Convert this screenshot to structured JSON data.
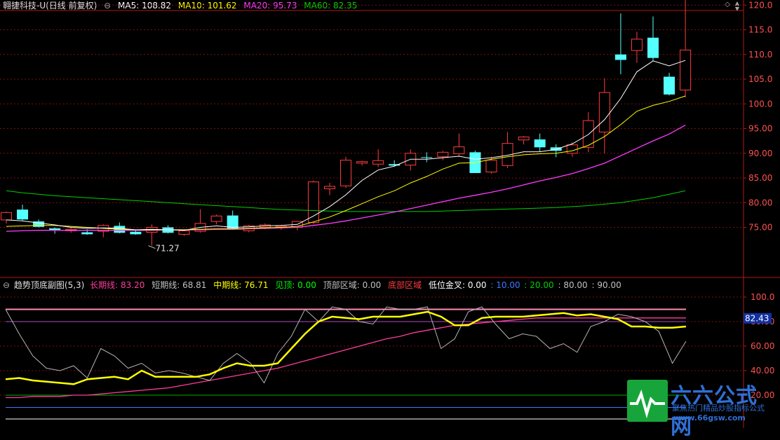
{
  "main_header": {
    "stock": "翱捷科技-U(日线 前复权)",
    "ma5": "MA5: 108.82",
    "ma10": "MA10: 101.62",
    "ma20": "MA20: 95.73",
    "ma60": "MA60: 82.35"
  },
  "sub_header": {
    "name": "趋势顶底副图(5,3)",
    "long": "长期线: 83.20",
    "short": "短期线: 68.81",
    "mid": "中期线: 76.71",
    "jianding": "见顶: 0.00",
    "top_zone": "顶部区域: 0.00",
    "bottom_zone": "底部区域",
    "low_cross": "低位金叉: 0.00",
    "v10": ": 10.00",
    "v20": ": 20.00",
    "v80": ": 80.00",
    "v90": ": 90.00"
  },
  "controls": {
    "diamond": "◇",
    "up": "▲",
    "down": "▼"
  },
  "colors": {
    "up": "#ff3c3c",
    "down": "#54ffff",
    "ma5": "#ffffff",
    "ma10": "#ffff00",
    "ma20": "#ff3cff",
    "ma60": "#00d000",
    "grid": "#7a1010",
    "axis": "#b01818"
  },
  "price_axis": {
    "ticks": [
      "120.0",
      "115.0",
      "110.0",
      "105.0",
      "100.0",
      "95.00",
      "90.00",
      "85.00",
      "80.00",
      "75.00"
    ]
  },
  "price_annotations": {
    "high": "122.40",
    "low": "71.27"
  },
  "sub_axis": {
    "ticks": [
      "100.0",
      "80.00",
      "60.00",
      "40.00",
      "20.00"
    ],
    "current": "82.43"
  },
  "chart_data": {
    "type": "candlestick",
    "ylim": [
      70,
      124
    ],
    "candles": [
      {
        "o": 76.5,
        "h": 78.2,
        "l": 75.8,
        "c": 78
      },
      {
        "o": 78.6,
        "h": 79.6,
        "l": 76.4,
        "c": 76.6
      },
      {
        "o": 76.2,
        "h": 76.6,
        "l": 75.0,
        "c": 75.1
      },
      {
        "o": 74.8,
        "h": 75.0,
        "l": 73.7,
        "c": 74.5
      },
      {
        "o": 74.3,
        "h": 74.9,
        "l": 73.9,
        "c": 74.6
      },
      {
        "o": 74.0,
        "h": 74.6,
        "l": 73.5,
        "c": 73.6
      },
      {
        "o": 74.2,
        "h": 75.6,
        "l": 73.0,
        "c": 75.4
      },
      {
        "o": 75.3,
        "h": 76.0,
        "l": 73.8,
        "c": 73.9
      },
      {
        "o": 74.1,
        "h": 74.6,
        "l": 73.5,
        "c": 73.6
      },
      {
        "o": 74.0,
        "h": 75.6,
        "l": 71.3,
        "c": 75.0
      },
      {
        "o": 75.0,
        "h": 75.4,
        "l": 73.8,
        "c": 73.9
      },
      {
        "o": 73.6,
        "h": 74.5,
        "l": 73.3,
        "c": 74.3
      },
      {
        "o": 74.2,
        "h": 78.7,
        "l": 73.9,
        "c": 75.8
      },
      {
        "o": 76.2,
        "h": 77.6,
        "l": 75.6,
        "c": 77.3
      },
      {
        "o": 77.4,
        "h": 78.4,
        "l": 74.6,
        "c": 74.8
      },
      {
        "o": 74.3,
        "h": 75.5,
        "l": 74.0,
        "c": 75.3
      },
      {
        "o": 75.0,
        "h": 75.8,
        "l": 74.6,
        "c": 75.5
      },
      {
        "o": 75.0,
        "h": 75.5,
        "l": 74.5,
        "c": 75.2
      },
      {
        "o": 75.0,
        "h": 76.3,
        "l": 74.4,
        "c": 76.2
      },
      {
        "o": 76.0,
        "h": 84.5,
        "l": 75.6,
        "c": 84.2
      },
      {
        "o": 82.8,
        "h": 84.0,
        "l": 81.5,
        "c": 83.3
      },
      {
        "o": 83.4,
        "h": 89.3,
        "l": 83.0,
        "c": 88.6
      },
      {
        "o": 88.0,
        "h": 88.5,
        "l": 87.5,
        "c": 88.3
      },
      {
        "o": 87.8,
        "h": 90.8,
        "l": 87.2,
        "c": 88.5
      },
      {
        "o": 87.8,
        "h": 88.6,
        "l": 87.3,
        "c": 87.5
      },
      {
        "o": 87.6,
        "h": 90.8,
        "l": 86.5,
        "c": 90.0
      },
      {
        "o": 89.2,
        "h": 90.2,
        "l": 88.2,
        "c": 89.1
      },
      {
        "o": 89.3,
        "h": 90.5,
        "l": 88.6,
        "c": 90.2
      },
      {
        "o": 89.9,
        "h": 94.0,
        "l": 89.3,
        "c": 91.3
      },
      {
        "o": 90.2,
        "h": 90.5,
        "l": 86.0,
        "c": 86.0
      },
      {
        "o": 86.2,
        "h": 89.3,
        "l": 85.9,
        "c": 88.6
      },
      {
        "o": 87.5,
        "h": 94.3,
        "l": 87.0,
        "c": 92.0
      },
      {
        "o": 92.7,
        "h": 93.5,
        "l": 91.8,
        "c": 93.3
      },
      {
        "o": 92.8,
        "h": 94.0,
        "l": 90.3,
        "c": 91.2
      },
      {
        "o": 91.2,
        "h": 91.8,
        "l": 89.2,
        "c": 90.5
      },
      {
        "o": 90.0,
        "h": 92.2,
        "l": 89.3,
        "c": 91.7
      },
      {
        "o": 91.2,
        "h": 98.3,
        "l": 90.2,
        "c": 96.6
      },
      {
        "o": 94.3,
        "h": 105.2,
        "l": 90.0,
        "c": 102.3
      },
      {
        "o": 110.0,
        "h": 118.3,
        "l": 106.0,
        "c": 108.9
      },
      {
        "o": 110.8,
        "h": 114.6,
        "l": 108.3,
        "c": 113.1
      },
      {
        "o": 113.4,
        "h": 117.7,
        "l": 108.7,
        "c": 109.3
      },
      {
        "o": 105.5,
        "h": 106.3,
        "l": 101.7,
        "c": 101.9
      },
      {
        "o": 102.8,
        "h": 122.4,
        "l": 101.3,
        "c": 110.9
      }
    ],
    "ma5": [
      76.5,
      76.3,
      75.9,
      75.5,
      75.0,
      74.8,
      74.9,
      74.8,
      74.5,
      74.6,
      74.5,
      74.4,
      75.0,
      75.3,
      75.0,
      75.1,
      75.3,
      75.4,
      75.6,
      77.3,
      79.2,
      81.6,
      84.5,
      86.6,
      87.4,
      88.8,
      88.8,
      89.1,
      89.4,
      88.8,
      89.1,
      89.6,
      90.3,
      90.3,
      90.8,
      91.9,
      93.8,
      96.8,
      101.1,
      106.5,
      108.7,
      107.7,
      108.8
    ],
    "ma10": [
      75.2,
      75.3,
      75.4,
      75.4,
      75.2,
      75.0,
      74.8,
      74.6,
      74.5,
      74.5,
      74.5,
      74.5,
      74.6,
      74.7,
      74.7,
      74.8,
      74.9,
      75.0,
      75.2,
      76.1,
      77.1,
      78.4,
      79.8,
      81.2,
      82.4,
      84.0,
      85.3,
      86.8,
      88.0,
      88.1,
      88.8,
      89.3,
      89.7,
      89.9,
      90.0,
      90.5,
      91.6,
      93.4,
      95.8,
      98.5,
      99.7,
      100.5,
      101.6
    ],
    "ma20": [
      74.2,
      74.3,
      74.4,
      74.4,
      74.4,
      74.4,
      74.4,
      74.4,
      74.4,
      74.4,
      74.5,
      74.5,
      74.5,
      74.6,
      74.6,
      74.7,
      74.8,
      74.9,
      75.0,
      75.4,
      75.8,
      76.3,
      76.9,
      77.5,
      78.1,
      78.8,
      79.5,
      80.2,
      80.9,
      81.5,
      82.1,
      82.8,
      83.6,
      84.4,
      85.1,
      85.9,
      86.9,
      88.0,
      89.5,
      91.0,
      92.5,
      93.9,
      95.7
    ],
    "ma60": [
      82.4,
      82.0,
      81.7,
      81.4,
      81.2,
      81.0,
      80.8,
      80.6,
      80.4,
      80.2,
      80.0,
      79.8,
      79.6,
      79.4,
      79.2,
      79.0,
      78.8,
      78.6,
      78.5,
      78.4,
      78.3,
      78.2,
      78.2,
      78.2,
      78.2,
      78.2,
      78.2,
      78.3,
      78.4,
      78.5,
      78.6,
      78.7,
      78.8,
      78.9,
      79.0,
      79.2,
      79.4,
      79.7,
      80.0,
      80.5,
      81.0,
      81.7,
      82.4
    ],
    "sub": {
      "ylim": [
        0,
        108
      ],
      "short": [
        90,
        70,
        52,
        42,
        40,
        44,
        34,
        58,
        52,
        42,
        46,
        38,
        40,
        38,
        35,
        32,
        46,
        54,
        46,
        30,
        54,
        68,
        90,
        80,
        92,
        90,
        80,
        78,
        92,
        90,
        90,
        92,
        58,
        66,
        88,
        92,
        78,
        66,
        70,
        68,
        58,
        62,
        55,
        76,
        80,
        86,
        84,
        80,
        72,
        46,
        64
      ],
      "mid": [
        33,
        34,
        32,
        31,
        30,
        29,
        33,
        34,
        35,
        33,
        40,
        35,
        35,
        35,
        35,
        37,
        42,
        46,
        44,
        44,
        46,
        58,
        70,
        80,
        84,
        83,
        82,
        84,
        84,
        84,
        86,
        88,
        84,
        77,
        77,
        83,
        84,
        84,
        84,
        85,
        86,
        87,
        85,
        86,
        84,
        82,
        76,
        76,
        75,
        75,
        76
      ],
      "long": [
        18,
        18,
        19,
        19,
        19,
        20,
        20,
        21,
        22,
        23,
        24,
        25,
        26,
        28,
        30,
        32,
        34,
        36,
        38,
        40,
        42,
        45,
        48,
        51,
        54,
        57,
        60,
        63,
        66,
        68,
        71,
        73,
        75,
        77,
        78,
        79,
        80,
        81,
        82,
        83,
        83,
        83,
        83,
        83,
        83,
        83,
        83,
        83,
        83,
        83,
        83
      ]
    }
  },
  "logo": {
    "title": "六六公式网",
    "sub": "聚焦热门精品炒股指标公式",
    "url": "www.66gsw.com"
  }
}
